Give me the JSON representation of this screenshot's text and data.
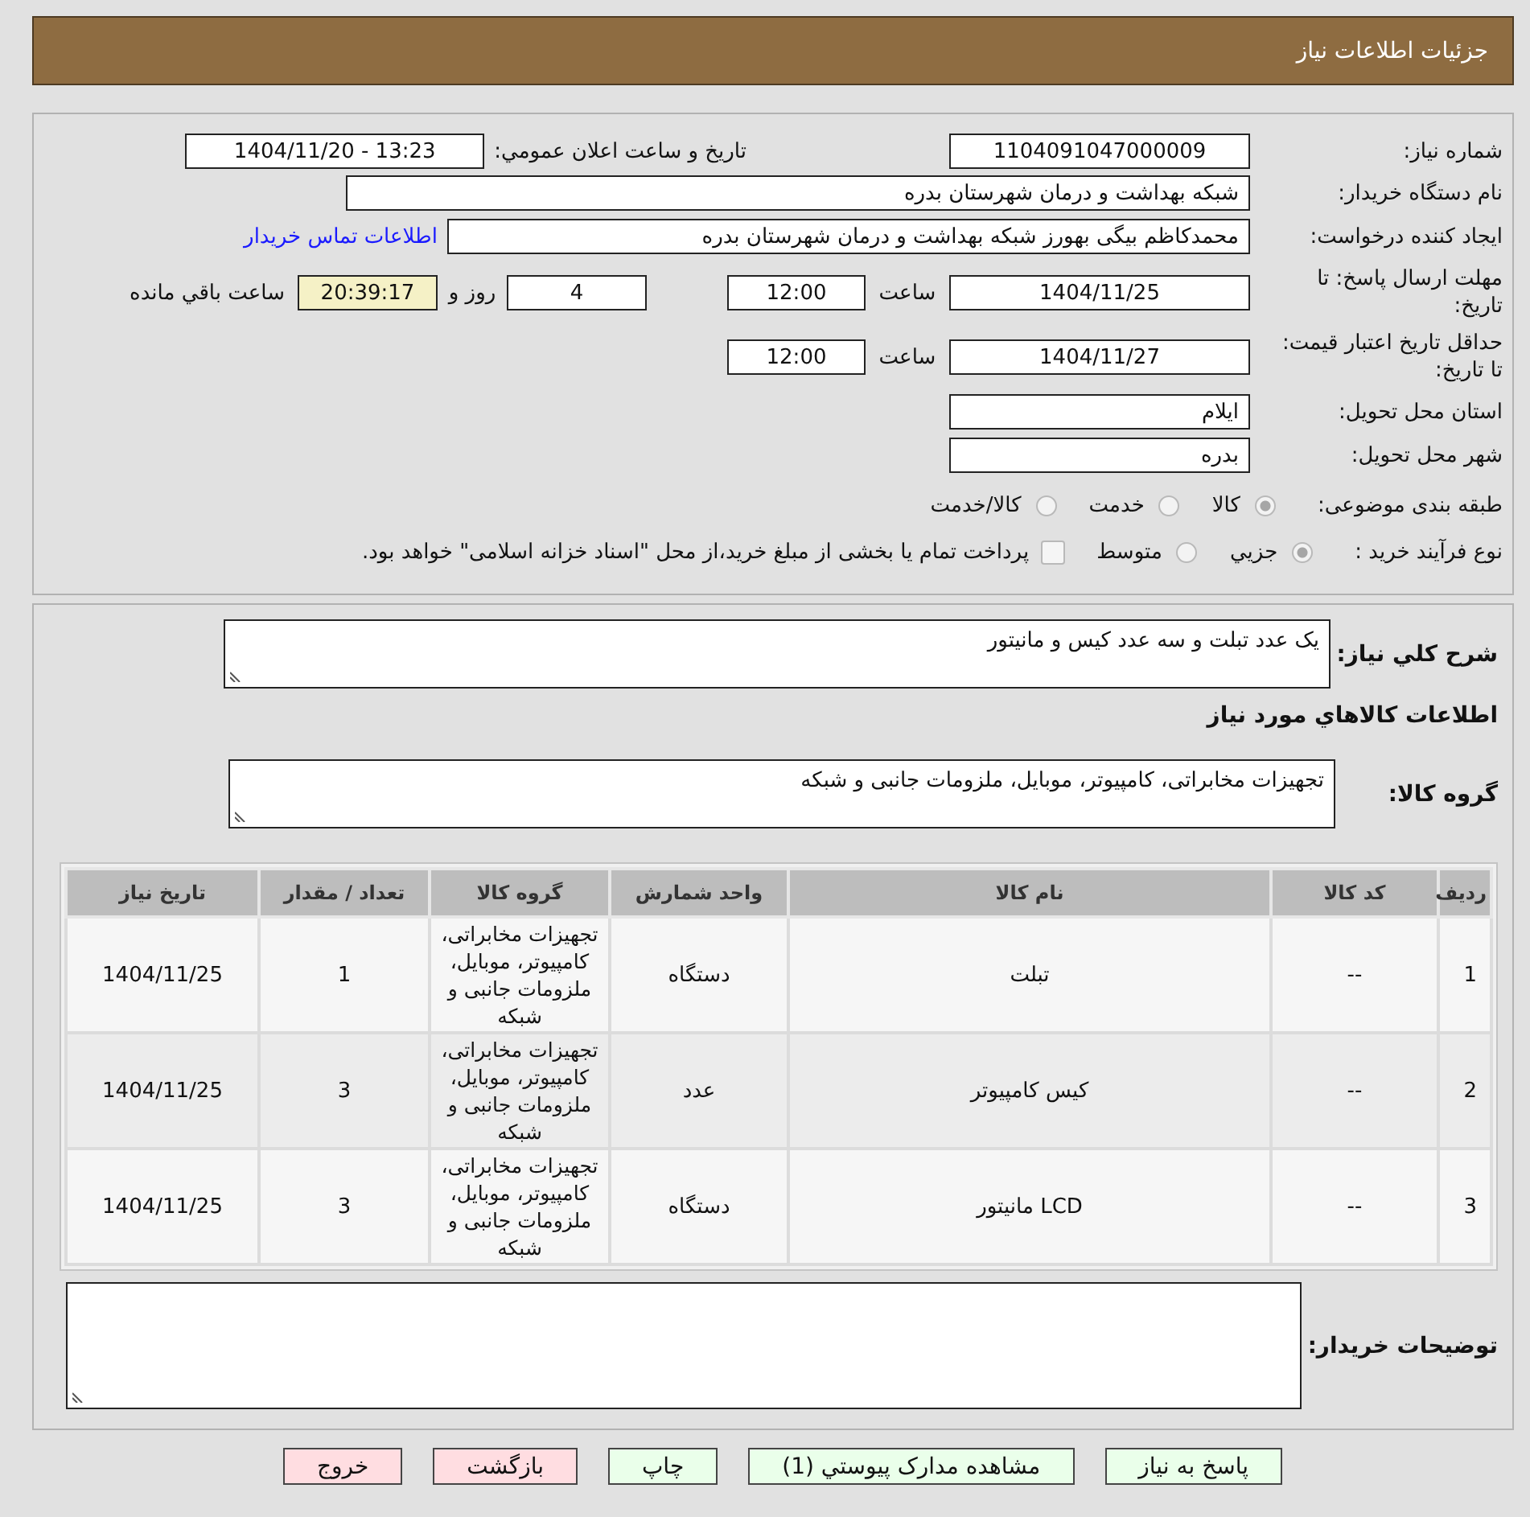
{
  "header": {
    "title": "جزئیات اطلاعات نیاز"
  },
  "info": {
    "need_number": {
      "label": "شماره نیاز:",
      "value": "1104091047000009"
    },
    "announce": {
      "label": "تاریخ و ساعت اعلان عمومي:",
      "value": "1404/11/20 - 13:23"
    },
    "buyer": {
      "label": "نام دستگاه خریدار:",
      "value": "شبکه بهداشت و درمان شهرستان بدره"
    },
    "creator": {
      "label": "ایجاد کننده درخواست:",
      "value": "محمدکاظم بیگی بهورز شبکه بهداشت و درمان شهرستان بدره",
      "link": "اطلاعات تماس خریدار"
    },
    "deadline": {
      "label": "مهلت ارسال پاسخ: تا تاریخ:",
      "date": "1404/11/25",
      "time_label": "ساعت",
      "time": "12:00",
      "days": "4",
      "days_label": "روز و",
      "remaining": "20:39:17",
      "remaining_label": "ساعت باقي مانده"
    },
    "validity": {
      "label": "حداقل تاریخ اعتبار قیمت: تا تاریخ:",
      "date": "1404/11/27",
      "time_label": "ساعت",
      "time": "12:00"
    },
    "province": {
      "label": "استان محل تحویل:",
      "value": "ایلام"
    },
    "city": {
      "label": "شهر محل تحویل:",
      "value": "بدره"
    },
    "category": {
      "label": "طبقه بندی موضوعی:",
      "options": [
        {
          "label": "کالا",
          "selected": true
        },
        {
          "label": "خدمت",
          "selected": false
        },
        {
          "label": "کالا/خدمت",
          "selected": false
        }
      ]
    },
    "process": {
      "label": "نوع فرآیند خرید :",
      "options": [
        {
          "label": "جزيي",
          "selected": true
        },
        {
          "label": "متوسط",
          "selected": false
        }
      ],
      "treasury": {
        "label": "پرداخت تمام یا بخشی از مبلغ خرید،از محل \"اسناد خزانه اسلامی\" خواهد بود.",
        "checked": false
      }
    }
  },
  "needs": {
    "summary": {
      "label": "شرح کلي نیاز:",
      "value": "یک عدد تبلت و سه عدد کیس و مانیتور"
    },
    "goods_title": "اطلاعات کالاهاي مورد نياز",
    "group": {
      "label": "گروه کالا:",
      "value": "تجهیزات مخابراتی، کامپیوتر، موبایل، ملزومات جانبی و شبکه"
    },
    "table": {
      "columns": [
        "ردیف",
        "کد کالا",
        "نام کالا",
        "واحد شمارش",
        "گروه کالا",
        "تعداد / مقدار",
        "تاریخ نیاز"
      ],
      "rows": [
        [
          "1",
          "--",
          "تبلت",
          "دستگاه",
          "تجهیزات مخابراتی، کامپیوتر، موبایل، ملزومات جانبی و شبکه",
          "1",
          "1404/11/25"
        ],
        [
          "2",
          "--",
          "کیس کامپیوتر",
          "عدد",
          "تجهیزات مخابراتی، کامپیوتر، موبایل، ملزومات جانبی و شبکه",
          "3",
          "1404/11/25"
        ],
        [
          "3",
          "--",
          "مانیتور LCD",
          "دستگاه",
          "تجهیزات مخابراتی، کامپیوتر، موبایل، ملزومات جانبی و شبکه",
          "3",
          "1404/11/25"
        ]
      ]
    },
    "buyer_notes": {
      "label": "توضیحات خریدار:"
    }
  },
  "buttons": [
    {
      "label": "پاسخ به نیاز",
      "kind": "positive"
    },
    {
      "label": "مشاهده مدارک پیوستي (1)",
      "kind": "positive"
    },
    {
      "label": "چاپ",
      "kind": "positive"
    },
    {
      "label": "بازگشت",
      "kind": "negative"
    },
    {
      "label": "خروج",
      "kind": "negative"
    }
  ]
}
